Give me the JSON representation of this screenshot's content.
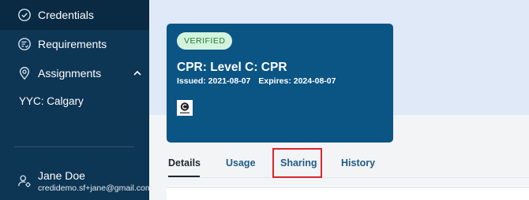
{
  "sidebar": {
    "items": [
      {
        "label": "Credentials",
        "icon": "badge-check-icon",
        "active": true
      },
      {
        "label": "Requirements",
        "icon": "list-check-icon"
      },
      {
        "label": "Assignments",
        "icon": "location-pin-icon",
        "expanded": true
      }
    ],
    "sub_item": "YYC: Calgary",
    "user": {
      "name": "Jane Doe",
      "email": "credidemo.sf+jane@gmail.com",
      "icon": "user-gear-icon"
    }
  },
  "credential": {
    "status": "VERIFIED",
    "title": "CPR: Level C: CPR",
    "issued": "Issued: 2021-08-07",
    "expires": "Expires: 2024-08-07",
    "logo_icon": "issuer-logo-icon"
  },
  "tabs": [
    {
      "label": "Details",
      "active": true
    },
    {
      "label": "Usage"
    },
    {
      "label": "Sharing",
      "highlighted": true
    },
    {
      "label": "History"
    }
  ],
  "colors": {
    "sidebar_bg": "#0d3554",
    "card_bg": "#0b5585",
    "badge_bg": "#d4f3dc",
    "badge_text": "#1f7a3d",
    "highlight": "#d9262b",
    "tab_text": "#1f5c86"
  }
}
